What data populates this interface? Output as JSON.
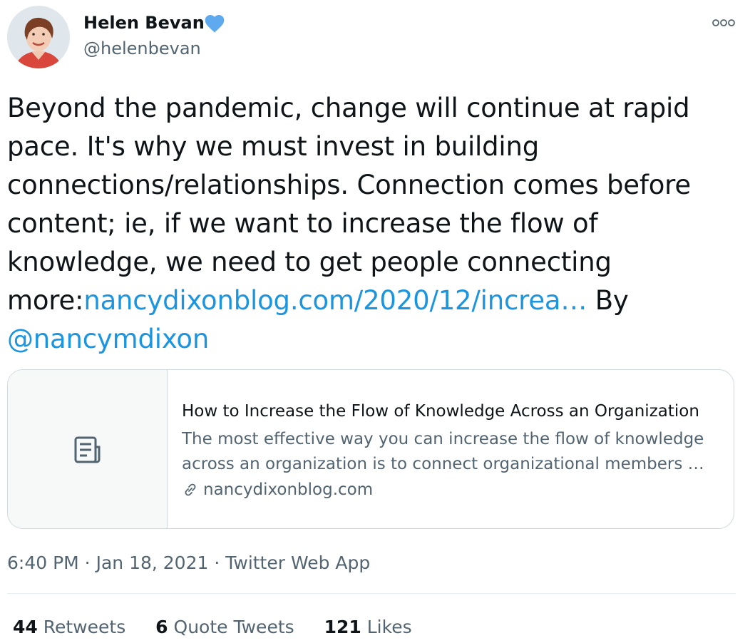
{
  "author": {
    "name": "Helen Bevan",
    "handle": "@helenbevan",
    "verified_color": "#5fa9ee"
  },
  "tweet": {
    "text_lines": [
      "Beyond the pandemic, change will continue at rapid",
      "pace. It's why we must invest in building",
      "connections/relationships. Connection comes before",
      "content; ie, if we want to increase the flow of",
      "knowledge, we need to get people connecting"
    ],
    "last_prefix": "more:",
    "link_text": "nancydixonblog.com/2020/12/increa…",
    "by_text": " By",
    "mention": "@nancymdixon"
  },
  "card": {
    "title": "How to Increase the Flow of Knowledge Across an Organization",
    "desc_line1": "The most effective way you can increase the flow of knowledge",
    "desc_line2": "across an organization is to connect  organizational members …",
    "domain": "nancydixonblog.com",
    "icon": "article-icon"
  },
  "meta": {
    "time": "6:40 PM",
    "sep1": " · ",
    "date": "Jan 18, 2021",
    "sep2": " · ",
    "source": "Twitter Web App"
  },
  "stats": {
    "retweets_count": "44",
    "retweets_label": "Retweets",
    "quotes_count": "6",
    "quotes_label": "Quote Tweets",
    "likes_count": "121",
    "likes_label": "Likes"
  },
  "colors": {
    "link": "#1b95e0",
    "secondary_text": "#536471",
    "border": "#cfd9de"
  }
}
